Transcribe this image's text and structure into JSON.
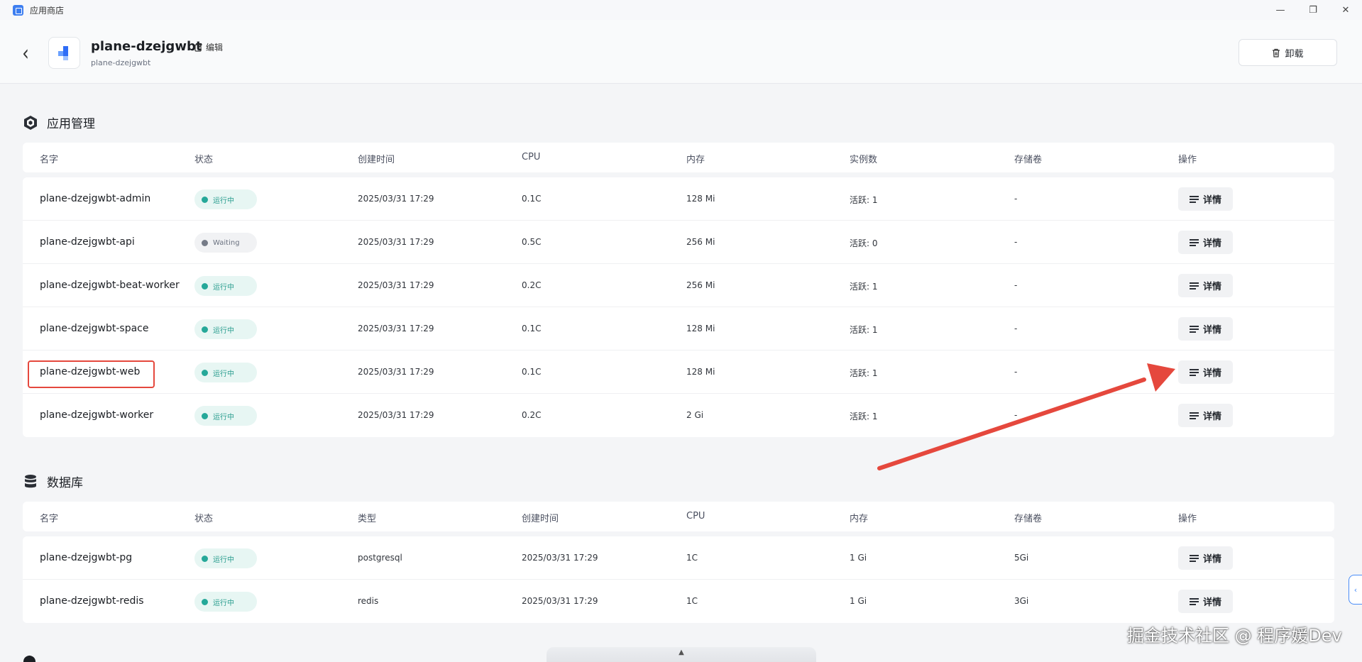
{
  "window": {
    "title": "应用商店",
    "minimize_glyph": "—",
    "maximize_glyph": "❐",
    "close_glyph": "✕"
  },
  "header": {
    "back_glyph": "‹",
    "app_name": "plane-dzejgwbt",
    "edit_label": "编辑",
    "app_subname": "plane-dzejgwbt",
    "uninstall_label": "卸载"
  },
  "apps": {
    "title": "应用管理",
    "columns": [
      "名字",
      "状态",
      "创建时间",
      "CPU",
      "内存",
      "实例数",
      "存储卷",
      "操作"
    ],
    "rows": [
      {
        "name": "plane-dzejgwbt-admin",
        "status": "运行中",
        "status_kind": "running",
        "created": "2025/03/31 17:29",
        "cpu": "0.1C",
        "memory": "128 Mi",
        "instances": "活跃: 1",
        "volume": "-",
        "action": "详情"
      },
      {
        "name": "plane-dzejgwbt-api",
        "status": "Waiting",
        "status_kind": "waiting",
        "created": "2025/03/31 17:29",
        "cpu": "0.5C",
        "memory": "256 Mi",
        "instances": "活跃: 0",
        "volume": "-",
        "action": "详情"
      },
      {
        "name": "plane-dzejgwbt-beat-worker",
        "status": "运行中",
        "status_kind": "running",
        "created": "2025/03/31 17:29",
        "cpu": "0.2C",
        "memory": "256 Mi",
        "instances": "活跃: 1",
        "volume": "-",
        "action": "详情"
      },
      {
        "name": "plane-dzejgwbt-space",
        "status": "运行中",
        "status_kind": "running",
        "created": "2025/03/31 17:29",
        "cpu": "0.1C",
        "memory": "128 Mi",
        "instances": "活跃: 1",
        "volume": "-",
        "action": "详情"
      },
      {
        "name": "plane-dzejgwbt-web",
        "status": "运行中",
        "status_kind": "running",
        "created": "2025/03/31 17:29",
        "cpu": "0.1C",
        "memory": "128 Mi",
        "instances": "活跃: 1",
        "volume": "-",
        "action": "详情"
      },
      {
        "name": "plane-dzejgwbt-worker",
        "status": "运行中",
        "status_kind": "running",
        "created": "2025/03/31 17:29",
        "cpu": "0.2C",
        "memory": "2 Gi",
        "instances": "活跃: 1",
        "volume": "-",
        "action": "详情"
      }
    ]
  },
  "databases": {
    "title": "数据库",
    "columns": [
      "名字",
      "状态",
      "类型",
      "创建时间",
      "CPU",
      "内存",
      "存储卷",
      "操作"
    ],
    "rows": [
      {
        "name": "plane-dzejgwbt-pg",
        "status": "运行中",
        "status_kind": "running",
        "type": "postgresql",
        "created": "2025/03/31 17:29",
        "cpu": "1C",
        "memory": "1 Gi",
        "volume": "5Gi",
        "action": "详情"
      },
      {
        "name": "plane-dzejgwbt-redis",
        "status": "运行中",
        "status_kind": "running",
        "type": "redis",
        "created": "2025/03/31 17:29",
        "cpu": "1C",
        "memory": "1 Gi",
        "volume": "3Gi",
        "action": "详情"
      }
    ]
  },
  "side_tab_glyph": "‹",
  "bottom_toggle_glyph": "▲",
  "watermark": "掘金技术社区 @ 程序媛Dev",
  "colors": {
    "running": "#25a899",
    "waiting": "#757b87",
    "annotation": "#e5483d",
    "accent": "#4a8df8"
  },
  "icons": {
    "apps_section": "hexagon-cube-icon",
    "db_section": "database-icon",
    "edit": "edit-icon",
    "uninstall": "trash-icon",
    "detail": "lines-icon"
  }
}
